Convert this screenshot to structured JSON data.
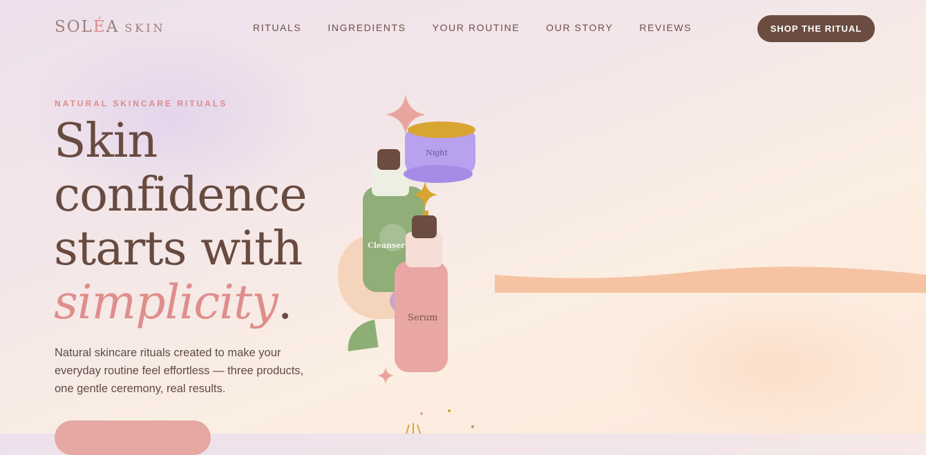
{
  "brand": {
    "logo_pre": "SOL",
    "logo_accent": "É",
    "logo_post": "A",
    "logo_sub": "SKIN"
  },
  "nav": {
    "links": [
      "RITUALS",
      "INGREDIENTS",
      "YOUR ROUTINE",
      "OUR STORY",
      "REVIEWS"
    ],
    "cta": "SHOP THE RITUAL"
  },
  "hero": {
    "eyebrow": "NATURAL SKINCARE RITUALS",
    "headline": {
      "line1": "Skin",
      "line2": "confidence",
      "line3": "starts with",
      "accent": "simplicity",
      "period": "."
    },
    "description": "Natural skincare rituals created to make your everyday routine feel effortless — three products, one gentle ceremony, real results."
  },
  "illustration": {
    "products": {
      "cleanser": "Cleanser",
      "night": "Night",
      "serum": "Serum"
    }
  },
  "colors": {
    "brown": "#6b4c41",
    "rose": "#df8e8c",
    "sage": "#8fae78",
    "lilac": "#b8a1ee",
    "gold": "#d8a532",
    "pink": "#e8a7a4",
    "peach": "#f5c3a2"
  },
  "icons": [
    "sparkle-icon",
    "star-icon",
    "leaf-icon"
  ]
}
